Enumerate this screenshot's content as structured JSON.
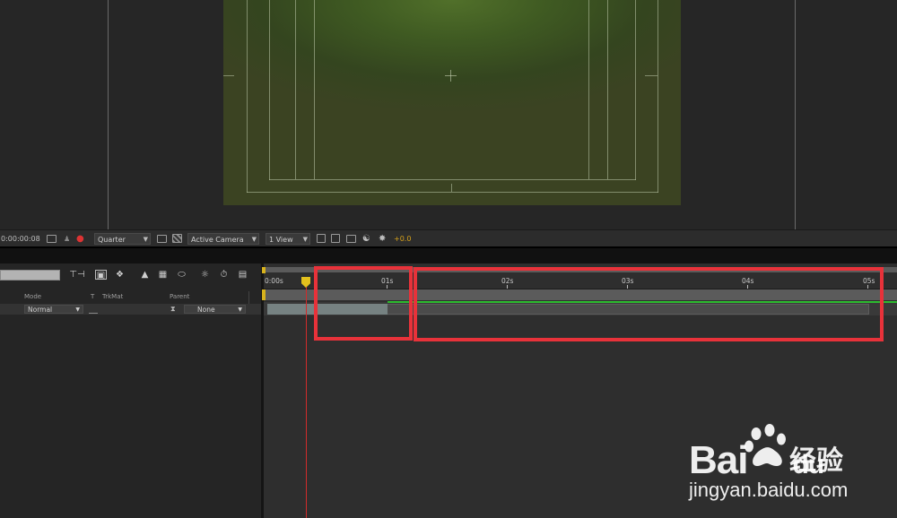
{
  "viewer_bar": {
    "timecode": "0:00:00:08",
    "resolution": "Quarter",
    "camera": "Active Camera",
    "views": "1 View",
    "exposure": "+0.0"
  },
  "timeline": {
    "columns": {
      "mode": "Mode",
      "t": "T",
      "trkmat": "TrkMat",
      "parent": "Parent"
    },
    "layer": {
      "mode": "Normal",
      "parent": "None"
    },
    "ruler_ticks": [
      "0:00s",
      "01s",
      "02s",
      "03s",
      "04s",
      "05s"
    ]
  },
  "watermark": {
    "logo": "Bai",
    "logo_tail": "du",
    "cn": "经验",
    "url": "jingyan.baidu.com"
  },
  "colors": {
    "highlight": "#e8323a",
    "cti": "#d12b2b",
    "cti_head": "#e4c11d",
    "green_line": "#2dbb2f"
  }
}
